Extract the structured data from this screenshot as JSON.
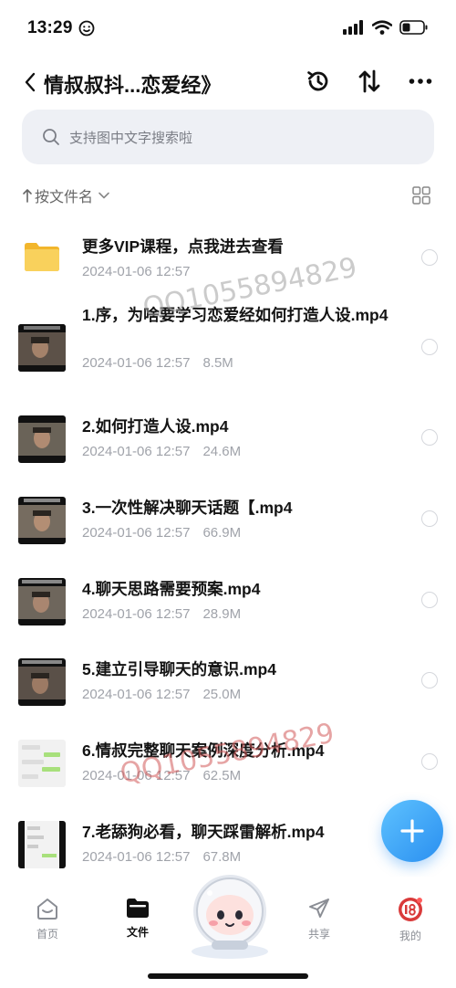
{
  "status_bar": {
    "time": "13:29"
  },
  "nav": {
    "title": "情叔叔抖...恋爱经》"
  },
  "search": {
    "placeholder": "支持图中文字搜索啦"
  },
  "sort": {
    "label": "按文件名"
  },
  "files": [
    {
      "name": "更多VIP课程，点我进去查看",
      "date": "2024-01-06 12:57",
      "size": "",
      "type": "folder"
    },
    {
      "name": "1.序，为啥要学习恋爱经如何打造人设.mp4",
      "date": "2024-01-06 12:57",
      "size": "8.5M",
      "type": "video"
    },
    {
      "name": "2.如何打造人设.mp4",
      "date": "2024-01-06 12:57",
      "size": "24.6M",
      "type": "video"
    },
    {
      "name": "3.一次性解决聊天话题【.mp4",
      "date": "2024-01-06 12:57",
      "size": "66.9M",
      "type": "video"
    },
    {
      "name": "4.聊天思路需要预案.mp4",
      "date": "2024-01-06 12:57",
      "size": "28.9M",
      "type": "video"
    },
    {
      "name": "5.建立引导聊天的意识.mp4",
      "date": "2024-01-06 12:57",
      "size": "25.0M",
      "type": "video"
    },
    {
      "name": "6.情叔完整聊天案例深度分析.mp4",
      "date": "2024-01-06 12:57",
      "size": "62.5M",
      "type": "chat"
    },
    {
      "name": "7.老舔狗必看，聊天踩雷解析.mp4",
      "date": "2024-01-06 12:57",
      "size": "67.8M",
      "type": "chat"
    }
  ],
  "watermarks": [
    "QQ1055894829",
    "QQ1055894829"
  ],
  "tabs": [
    {
      "label": "首页",
      "icon": "home-icon"
    },
    {
      "label": "文件",
      "icon": "folder-icon"
    },
    {
      "label": "共享",
      "icon": "send-icon"
    },
    {
      "label": "我的",
      "icon": "avatar"
    }
  ],
  "colors": {
    "accent": "#2a8ff0",
    "folder": "#f7c948",
    "watermark": "#d25a5a"
  }
}
